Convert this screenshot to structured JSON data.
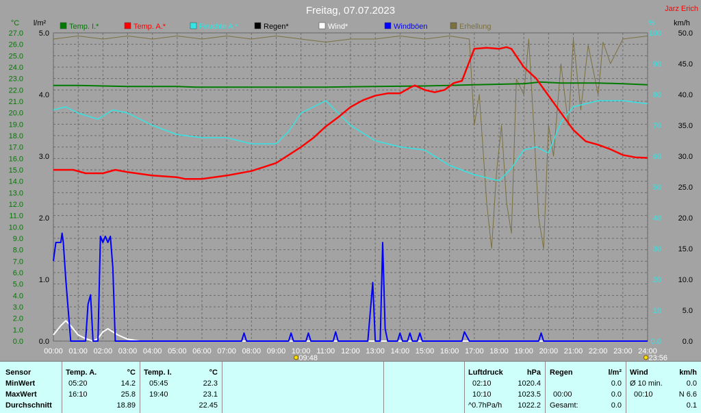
{
  "title": "Freitag, 07.07.2023",
  "author": "Jarz Erich",
  "colors": {
    "background": "#a3a3a3",
    "temp_inside": "#007a00",
    "temp_outside": "#ff0000",
    "humidity": "#33e5e5",
    "rain": "#000000",
    "wind": "#ffffff",
    "gusts": "#0000ff",
    "sunshine": "#7a7040",
    "table_bg": "#cffffb"
  },
  "chart_data": {
    "type": "line",
    "title": "Freitag, 07.07.2023",
    "x_ticks": [
      "00:00",
      "01:00",
      "02:00",
      "03:00",
      "04:00",
      "05:00",
      "06:00",
      "07:00",
      "08:00",
      "09:00",
      "10:00",
      "11:00",
      "12:00",
      "13:00",
      "14:00",
      "15:00",
      "16:00",
      "17:00",
      "18:00",
      "19:00",
      "20:00",
      "21:00",
      "22:00",
      "23:00",
      "24:00"
    ],
    "x_range_hours": [
      0,
      24
    ],
    "axes": {
      "temp": {
        "unit": "°C",
        "range": [
          0,
          27
        ],
        "ticks": [
          "0.0",
          "1.0",
          "2.0",
          "3.0",
          "4.0",
          "5.0",
          "6.0",
          "7.0",
          "8.0",
          "9.0",
          "10.0",
          "11.0",
          "12.0",
          "13.0",
          "14.0",
          "15.0",
          "16.0",
          "17.0",
          "18.0",
          "19.0",
          "20.0",
          "21.0",
          "22.0",
          "23.0",
          "24.0",
          "25.0",
          "26.0",
          "27.0"
        ]
      },
      "rain": {
        "unit": "l/m²",
        "range": [
          0,
          5
        ],
        "ticks": [
          "0.0",
          "1.0",
          "2.0",
          "3.0",
          "4.0",
          "5.0"
        ]
      },
      "humidity": {
        "unit": "%",
        "range": [
          0,
          100
        ],
        "ticks": [
          "0.0",
          "10",
          "20",
          "30",
          "40",
          "50",
          "60",
          "70",
          "80",
          "90",
          "100"
        ]
      },
      "wind": {
        "unit": "km/h",
        "range": [
          0,
          50
        ],
        "ticks": [
          "0.0",
          "5.0",
          "10.0",
          "15.0",
          "20.0",
          "25.0",
          "30.0",
          "35.0",
          "40.0",
          "45.0",
          "50.0"
        ]
      }
    },
    "grid": true,
    "legend_position": "top",
    "annotations": [
      {
        "text": "09:48",
        "hour": 9.8
      },
      {
        "text": "23:56",
        "hour": 23.93
      }
    ],
    "series": [
      {
        "name": "Temp. I.*",
        "axis": "temp",
        "color": "#007a00",
        "points": [
          [
            0,
            22.4
          ],
          [
            1,
            22.4
          ],
          [
            2,
            22.35
          ],
          [
            3,
            22.3
          ],
          [
            4,
            22.3
          ],
          [
            5,
            22.3
          ],
          [
            5.75,
            22.25
          ],
          [
            7,
            22.25
          ],
          [
            9,
            22.25
          ],
          [
            11,
            22.25
          ],
          [
            13,
            22.3
          ],
          [
            15,
            22.35
          ],
          [
            16,
            22.4
          ],
          [
            17,
            22.45
          ],
          [
            18,
            22.5
          ],
          [
            19,
            22.55
          ],
          [
            19.67,
            22.7
          ],
          [
            20.5,
            22.6
          ],
          [
            22,
            22.6
          ],
          [
            23,
            22.55
          ],
          [
            24,
            22.45
          ]
        ]
      },
      {
        "name": "Temp. A.*",
        "axis": "temp",
        "color": "#ff0000",
        "points": [
          [
            0,
            15.0
          ],
          [
            0.8,
            15.0
          ],
          [
            1.3,
            14.7
          ],
          [
            2,
            14.7
          ],
          [
            2.5,
            15.0
          ],
          [
            3,
            14.8
          ],
          [
            4,
            14.5
          ],
          [
            5,
            14.35
          ],
          [
            5.33,
            14.2
          ],
          [
            6,
            14.2
          ],
          [
            7,
            14.5
          ],
          [
            8,
            14.9
          ],
          [
            9,
            15.6
          ],
          [
            10,
            17.0
          ],
          [
            10.5,
            17.8
          ],
          [
            11,
            18.8
          ],
          [
            11.5,
            19.6
          ],
          [
            12,
            20.5
          ],
          [
            12.5,
            21.1
          ],
          [
            13,
            21.5
          ],
          [
            13.5,
            21.7
          ],
          [
            14,
            21.7
          ],
          [
            14.4,
            22.2
          ],
          [
            14.6,
            22.4
          ],
          [
            15,
            22.0
          ],
          [
            15.4,
            21.8
          ],
          [
            15.8,
            22.0
          ],
          [
            16.17,
            22.6
          ],
          [
            16.5,
            22.8
          ],
          [
            17,
            25.6
          ],
          [
            17.5,
            25.7
          ],
          [
            18,
            25.6
          ],
          [
            18.3,
            25.75
          ],
          [
            18.5,
            25.6
          ],
          [
            19,
            24.0
          ],
          [
            19.5,
            23.0
          ],
          [
            20,
            21.5
          ],
          [
            20.5,
            20.0
          ],
          [
            21,
            18.5
          ],
          [
            21.5,
            17.5
          ],
          [
            22,
            17.2
          ],
          [
            22.5,
            16.8
          ],
          [
            23,
            16.3
          ],
          [
            23.5,
            16.1
          ],
          [
            24,
            16.05
          ]
        ]
      },
      {
        "name": "Feuchte A.*",
        "axis": "humidity",
        "color": "#33e5e5",
        "points": [
          [
            0,
            75
          ],
          [
            0.5,
            76
          ],
          [
            1,
            74
          ],
          [
            1.8,
            72
          ],
          [
            2.4,
            75
          ],
          [
            3,
            74
          ],
          [
            4,
            70
          ],
          [
            5,
            67
          ],
          [
            6,
            66
          ],
          [
            7,
            66
          ],
          [
            8,
            64
          ],
          [
            9,
            64
          ],
          [
            9.5,
            68
          ],
          [
            10,
            74
          ],
          [
            11,
            78
          ],
          [
            11.5,
            74
          ],
          [
            12,
            70
          ],
          [
            13,
            65
          ],
          [
            14,
            63
          ],
          [
            15,
            62
          ],
          [
            16,
            57
          ],
          [
            17,
            54
          ],
          [
            18,
            52
          ],
          [
            18.5,
            56
          ],
          [
            19,
            62
          ],
          [
            19.5,
            63
          ],
          [
            20,
            61
          ],
          [
            20.5,
            71
          ],
          [
            21,
            76
          ],
          [
            22,
            78
          ],
          [
            23,
            78
          ],
          [
            24,
            77
          ]
        ]
      },
      {
        "name": "Wind*",
        "axis": "wind",
        "color": "#ffffff",
        "points": [
          [
            0,
            1.0
          ],
          [
            0.3,
            2.5
          ],
          [
            0.5,
            3.3
          ],
          [
            0.7,
            2.5
          ],
          [
            1,
            1.0
          ],
          [
            1.3,
            0.4
          ],
          [
            1.6,
            0
          ],
          [
            1.8,
            0.4
          ],
          [
            2,
            1.5
          ],
          [
            2.2,
            2.0
          ],
          [
            2.4,
            1.5
          ],
          [
            2.6,
            1.0
          ],
          [
            3,
            0.3
          ],
          [
            3.5,
            0
          ],
          [
            24,
            0
          ]
        ]
      },
      {
        "name": "Windböen",
        "axis": "wind",
        "color": "#0000ff",
        "points": [
          [
            0,
            13
          ],
          [
            0.1,
            16
          ],
          [
            0.3,
            16
          ],
          [
            0.35,
            17.5
          ],
          [
            0.4,
            16
          ],
          [
            0.5,
            10
          ],
          [
            0.7,
            0
          ],
          [
            1.3,
            0
          ],
          [
            1.4,
            6
          ],
          [
            1.5,
            7.5
          ],
          [
            1.6,
            0
          ],
          [
            1.8,
            0
          ],
          [
            1.9,
            17
          ],
          [
            2.0,
            16
          ],
          [
            2.1,
            17
          ],
          [
            2.2,
            16
          ],
          [
            2.3,
            17
          ],
          [
            2.4,
            12
          ],
          [
            2.5,
            0
          ],
          [
            7.6,
            0
          ],
          [
            7.7,
            1.3
          ],
          [
            7.8,
            0
          ],
          [
            9.5,
            0
          ],
          [
            9.6,
            1.3
          ],
          [
            9.7,
            0
          ],
          [
            10.2,
            0
          ],
          [
            10.3,
            1.3
          ],
          [
            10.4,
            0
          ],
          [
            11.3,
            0
          ],
          [
            11.4,
            1.5
          ],
          [
            11.5,
            0
          ],
          [
            12.7,
            0
          ],
          [
            12.9,
            9.5
          ],
          [
            13.0,
            0
          ],
          [
            13.2,
            0
          ],
          [
            13.3,
            16
          ],
          [
            13.4,
            2
          ],
          [
            13.5,
            0
          ],
          [
            13.9,
            0
          ],
          [
            14.0,
            1.3
          ],
          [
            14.1,
            0
          ],
          [
            14.3,
            0
          ],
          [
            14.4,
            1.3
          ],
          [
            14.5,
            0
          ],
          [
            14.7,
            0
          ],
          [
            14.8,
            1.3
          ],
          [
            14.9,
            0
          ],
          [
            16.5,
            0
          ],
          [
            16.6,
            1.5
          ],
          [
            16.8,
            0
          ],
          [
            19.6,
            0
          ],
          [
            19.7,
            1.3
          ],
          [
            19.8,
            0
          ],
          [
            24,
            0
          ]
        ]
      },
      {
        "name": "Erhellung",
        "axis": "humidity",
        "color": "#7a7040",
        "points": [
          [
            0,
            98
          ],
          [
            1,
            99
          ],
          [
            2,
            98
          ],
          [
            3,
            99
          ],
          [
            4,
            98
          ],
          [
            5,
            99
          ],
          [
            6,
            98
          ],
          [
            7,
            99
          ],
          [
            8,
            98
          ],
          [
            9,
            99
          ],
          [
            10,
            98
          ],
          [
            11,
            97
          ],
          [
            12,
            98
          ],
          [
            13,
            98
          ],
          [
            14,
            99
          ],
          [
            15,
            98
          ],
          [
            16,
            99
          ],
          [
            16.8,
            98
          ],
          [
            17,
            70
          ],
          [
            17.2,
            80
          ],
          [
            17.5,
            45
          ],
          [
            17.7,
            30
          ],
          [
            17.9,
            55
          ],
          [
            18.1,
            70
          ],
          [
            18.3,
            45
          ],
          [
            18.5,
            35
          ],
          [
            18.7,
            85
          ],
          [
            19,
            80
          ],
          [
            19.2,
            98
          ],
          [
            19.4,
            70
          ],
          [
            19.6,
            40
          ],
          [
            19.8,
            30
          ],
          [
            20,
            70
          ],
          [
            20.2,
            60
          ],
          [
            20.5,
            90
          ],
          [
            20.8,
            70
          ],
          [
            21,
            98
          ],
          [
            21.3,
            75
          ],
          [
            21.6,
            96
          ],
          [
            22,
            80
          ],
          [
            22.2,
            97
          ],
          [
            22.5,
            90
          ],
          [
            23,
            98
          ],
          [
            24,
            99
          ]
        ]
      },
      {
        "name": "Regen*",
        "axis": "rain",
        "color": "#000000",
        "points": []
      }
    ]
  },
  "legend": [
    {
      "label": "Temp. I.*",
      "color": "#007a00"
    },
    {
      "label": "Temp. A.*",
      "color": "#ff0000"
    },
    {
      "label": "Feuchte A.*",
      "color": "#33e5e5"
    },
    {
      "label": "Regen*",
      "color": "#000000"
    },
    {
      "label": "Wind*",
      "color": "#ffffff"
    },
    {
      "label": "Windböen",
      "color": "#0000ff"
    },
    {
      "label": "Erhellung",
      "color": "#7a7040"
    }
  ],
  "table": {
    "sensor": {
      "header": "Sensor",
      "rows": [
        "MinWert",
        "MaxWert",
        "Durchschnitt"
      ]
    },
    "temp_a": {
      "header": "Temp. A.",
      "unit": "°C",
      "min_time": "05:20",
      "min": "14.2",
      "max_time": "16:10",
      "max": "25.8",
      "avg": "18.89"
    },
    "temp_i": {
      "header": "Temp. I.",
      "unit": "°C",
      "min_time": "05:45",
      "min": "22.3",
      "max_time": "19:40",
      "max": "23.1",
      "avg": "22.45"
    },
    "pressure": {
      "header": "Luftdruck",
      "unit": "hPa",
      "min_time": "02:10",
      "min": "1020.4",
      "max_time": "10:10",
      "max": "1023.5",
      "trend": "^0.7hPa/h",
      "current": "1022.2"
    },
    "rain": {
      "header": "Regen",
      "unit": "l/m²",
      "row1": "0.0",
      "time": "00:00",
      "row2": "0.0",
      "total_label": "Gesamt:",
      "total": "0.0"
    },
    "wind": {
      "header": "Wind",
      "unit": "km/h",
      "avg_label": "Ø 10 min.",
      "avg": "0.0",
      "max_time": "00:10",
      "max": "N 6.6",
      "avg_day": "0.1"
    }
  }
}
